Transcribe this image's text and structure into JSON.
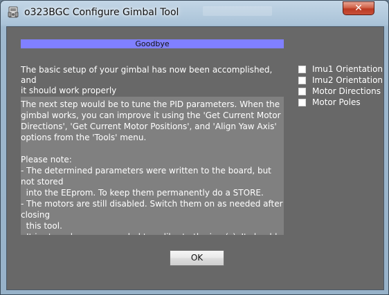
{
  "window": {
    "title": "o323BGC Configure Gimbal Tool",
    "close_label": "✕"
  },
  "dialog": {
    "header": "Goodbye",
    "intro": "The basic setup of your gimbal has now been accomplished, and\nit should work properly",
    "info": "The next step would be to tune the PID parameters. When the gimbal works, you can improve it using the 'Get Current Motor Directions', 'Get Current Motor Positions', and 'Align Yaw Axis' options from the 'Tools' menu.\n\nPlease note:\n- The determined parameters were written to the board, but not stored\n  into the EEprom. To keep them permanently do a STORE.\n- The motors are still disabled. Switch them on as needed after closing\n  this tool.\n- It is strongly recommended to calibrate the imu(s). It should have",
    "ok_label": "OK"
  },
  "checklist": [
    {
      "label": "Imu1 Orientation",
      "checked": false
    },
    {
      "label": "Imu2 Orientation",
      "checked": false
    },
    {
      "label": "Motor Directions",
      "checked": false
    },
    {
      "label": "Motor Poles",
      "checked": false
    }
  ],
  "colors": {
    "header_bar": "#8080ff",
    "client_bg": "#686868",
    "info_bg": "#808080"
  }
}
